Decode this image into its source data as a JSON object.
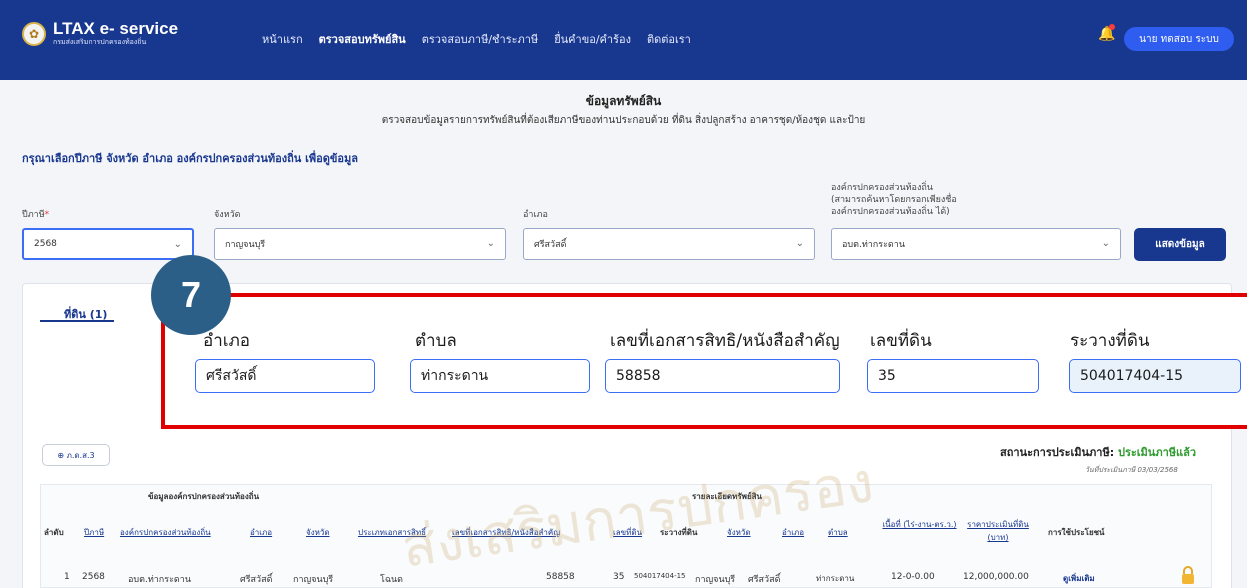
{
  "header": {
    "logo_title": "LTAX e- service",
    "logo_sub": "กรมส่งเสริมการปกครองท้องถิ่น",
    "nav": [
      "หน้าแรก",
      "ตรวจสอบทรัพย์สิน",
      "ตรวจสอบภาษี/ชำระภาษี",
      "ยื่นคำขอ/คำร้อง",
      "ติดต่อเรา"
    ],
    "user_button": "นาย ทดสอบ ระบบ",
    "bell_icon": "bell-icon"
  },
  "page": {
    "title": "ข้อมูลทรัพย์สิน",
    "subtitle": "ตรวจสอบข้อมูลรายการทรัพย์สินที่ต้องเสียภาษีของท่านประกอบด้วย ที่ดิน สิ่งปลูกสร้าง อาคารชุด/ห้องชุด และป้าย",
    "instruction": "กรุณาเลือกปีภาษี จังหวัด อำเภอ องค์กรปกครองส่วนท้องถิ่น เพื่อดูข้อมูล"
  },
  "filters": {
    "year_label": "ปีภาษี",
    "year_value": "2568",
    "province_label": "จังหวัด",
    "province_value": "กาญจนบุรี",
    "district_label": "อำเภอ",
    "district_value": "ศรีสวัสดิ์",
    "org_label_1": "องค์กรปกครองส่วนท้องถิ่น",
    "org_label_2": "(สามารถค้นหาโดยกรอกเพียงชื่อ",
    "org_label_3": "องค์กรปกครองส่วนท้องถิ่น ได้)",
    "org_value": "อบต.ท่ากระดาน",
    "show_button": "แสดงข้อมูล"
  },
  "tabs": {
    "land": "ที่ดิน (1)"
  },
  "step": "7",
  "detail": {
    "district_label": "อำเภอ",
    "district": "ศรีสวัสดิ์",
    "subdistrict_label": "ตำบล",
    "subdistrict": "ท่ากระดาน",
    "doc_no_label": "เลขที่เอกสารสิทธิ/หนังสือสำคัญ",
    "doc_no": "58858",
    "land_no_label": "เลขที่ดิน",
    "land_no": "35",
    "survey_label": "ระวางที่ดิน",
    "survey": "504017404-15"
  },
  "doc_button": "ภ.ด.ส.3",
  "status": {
    "label": "สถานะการประเมินภาษี:",
    "value": "ประเมินภาษีแล้ว",
    "date": "วันที่ประเมินภาษี 03/03/2568"
  },
  "table": {
    "group_org": "ข้อมูลองค์กรปกครองส่วนท้องถิ่น",
    "group_detail": "รายละเอียดทรัพย์สิน",
    "headers": [
      "ลำดับ",
      "ปีภาษี",
      "องค์กรปกครองส่วนท้องถิ่น",
      "อำเภอ",
      "จังหวัด",
      "ประเภทเอกสารสิทธิ์",
      "เลขที่เอกสารสิทธิ/หนังสือสำคัญ",
      "เลขที่ดิน",
      "ระวางที่ดิน",
      "จังหวัด",
      "อำเภอ",
      "ตำบล",
      "เนื้อที่ (ไร่-งาน-ตร.ว.)",
      "ราคาประเมินที่ดิน (บาท)",
      "การใช้ประโยชน์"
    ],
    "row": [
      "1",
      "2568",
      "อบต.ท่ากระดาน",
      "ศรีสวัสดิ์",
      "กาญจนบุรี",
      "โฉนด",
      "58858",
      "35",
      "504017404-15",
      "กาญจนบุรี",
      "ศรีสวัสดิ์",
      "ท่ากระดาน",
      "12-0-0.00",
      "12,000,000.00",
      "ดูเพิ่มเติม"
    ]
  },
  "watermark": "ส่งเสริมการปกครอง"
}
